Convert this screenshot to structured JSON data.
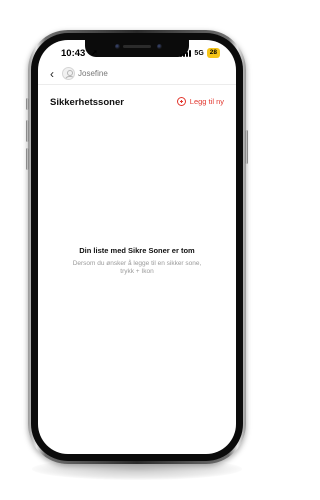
{
  "status_bar": {
    "time": "10:43",
    "network": "5G",
    "battery": "28"
  },
  "nav": {
    "contact_name": "Josefine"
  },
  "page": {
    "title": "Sikkerhetssoner",
    "add_label": "Legg til ny"
  },
  "empty_state": {
    "title": "Din liste med Sikre Soner er tom",
    "description": "Dersom du ønsker å legge til en sikker sone, trykk + Ikon"
  },
  "colors": {
    "accent": "#e2372e",
    "battery": "#f5c518"
  }
}
